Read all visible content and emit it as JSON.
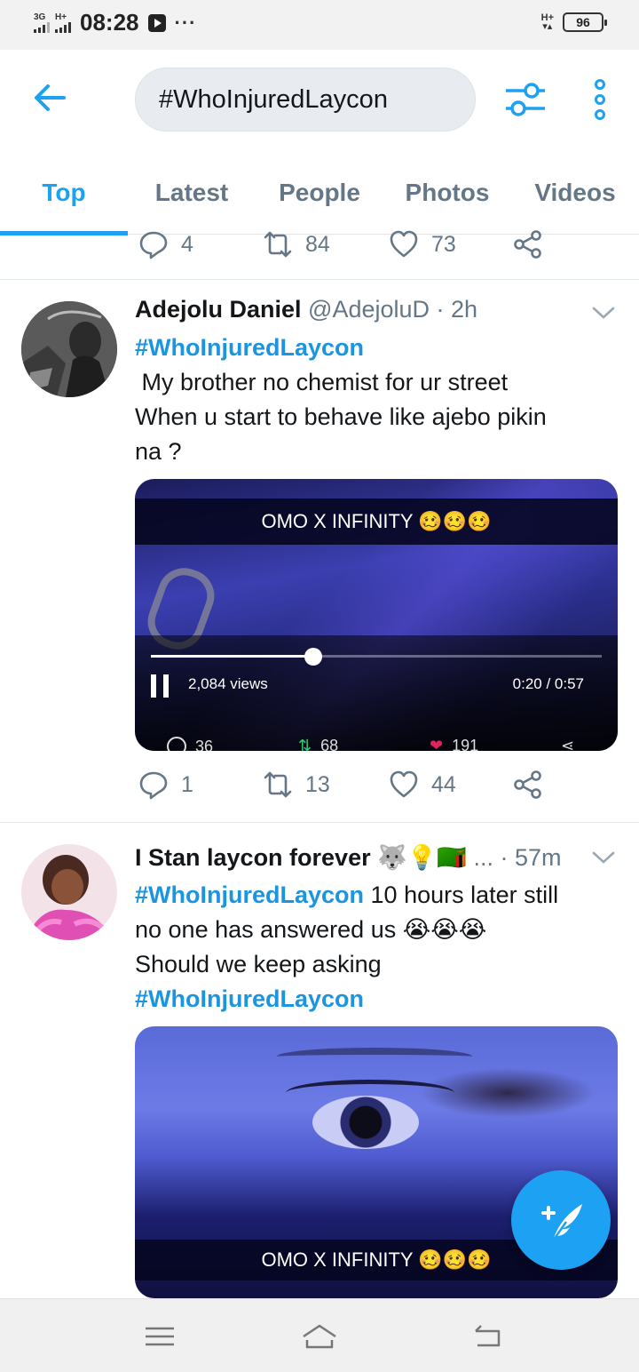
{
  "status_bar": {
    "sim1_label": "3G",
    "sim2_label": "H+",
    "time": "08:28",
    "more": "···",
    "net_label": "H+",
    "battery": "96"
  },
  "header": {
    "search_value": "#WhoInjuredLaycon"
  },
  "tabs": [
    "Top",
    "Latest",
    "People",
    "Photos",
    "Videos"
  ],
  "active_tab": "Top",
  "prev_tweet_actions": {
    "replies": "4",
    "retweets": "84",
    "likes": "73"
  },
  "tweets": [
    {
      "name": "Adejolu Daniel",
      "handle": "@AdejoluD",
      "time": "· 2h",
      "hashtag": "#WhoInjuredLaycon",
      "line1": " My brother no chemist for ur street",
      "line2": "When u start to behave like ajebo pikin",
      "line3": "na ?",
      "video": {
        "banner": "OMO X INFINITY 🥴🥴🥴",
        "views": "2,084 views",
        "time": "0:20 / 0:57",
        "progress": 0.36,
        "embedded_replies": "36",
        "embedded_retweets": "68",
        "embedded_likes": "191"
      },
      "actions": {
        "replies": "1",
        "retweets": "13",
        "likes": "44"
      }
    },
    {
      "name": "I Stan laycon forever 🐺💡🇿🇲",
      "handle": "...",
      "time": "· 57m",
      "hashtag1": "#WhoInjuredLaycon",
      "text1": " 10 hours later still",
      "text2": "no one has answered us 😭😭😭",
      "text3": "Should we keep asking",
      "hashtag2": "#WhoInjuredLaycon",
      "video": {
        "banner": "OMO X INFINITY 🥴🥴🥴"
      }
    }
  ],
  "colors": {
    "accent": "#1da1f2",
    "hashtag": "#1b95e0",
    "muted": "#657786"
  },
  "icons": [
    "back-arrow-icon",
    "filter-icon",
    "more-vertical-icon",
    "reply-icon",
    "retweet-icon",
    "like-icon",
    "share-icon",
    "chevron-down-icon",
    "compose-icon",
    "menu-icon",
    "home-icon",
    "back-icon"
  ]
}
